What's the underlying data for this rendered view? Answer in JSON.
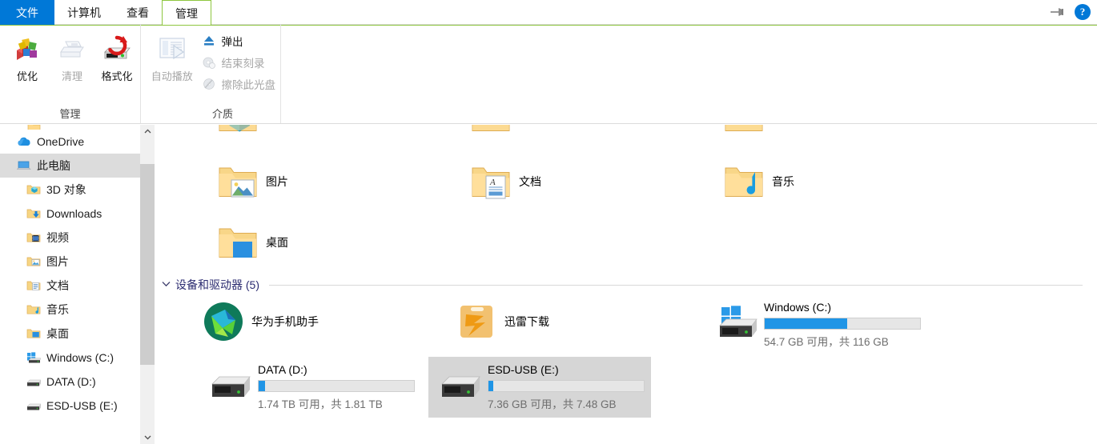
{
  "window": {
    "title": "此电脑"
  },
  "ribbon": {
    "tabs": [
      {
        "label": "文件",
        "type": "file"
      },
      {
        "label": "计算机",
        "type": "normal"
      },
      {
        "label": "查看",
        "type": "normal"
      },
      {
        "label": "管理",
        "type": "contextual-active"
      }
    ],
    "right_controls": [
      {
        "name": "pin-ribbon",
        "label": ""
      },
      {
        "name": "help",
        "label": "?"
      }
    ],
    "groups": [
      {
        "title": "管理",
        "big_buttons": [
          {
            "label": "优化",
            "icon": "optimize-icon",
            "enabled": true
          },
          {
            "label": "清理",
            "icon": "cleanup-icon",
            "enabled": false
          },
          {
            "label": "格式化",
            "icon": "format-icon",
            "enabled": true
          }
        ]
      },
      {
        "title": "介质",
        "big_buttons": [
          {
            "label": "自动播放",
            "icon": "autoplay-icon",
            "enabled": false
          }
        ],
        "small_buttons": [
          {
            "label": "弹出",
            "icon": "eject-icon",
            "enabled": true
          },
          {
            "label": "结束刻录",
            "icon": "finish-burning-icon",
            "enabled": false
          },
          {
            "label": "擦除此光盘",
            "icon": "erase-disc-icon",
            "enabled": false
          }
        ]
      }
    ]
  },
  "navpane": {
    "items": [
      {
        "label": "",
        "icon": "folder-icon",
        "level": 1,
        "selected": false,
        "partial": true
      },
      {
        "label": "OneDrive",
        "icon": "onedrive-icon",
        "level": 0,
        "selected": false
      },
      {
        "label": "此电脑",
        "icon": "this-pc-icon",
        "level": 0,
        "selected": true
      },
      {
        "label": "3D 对象",
        "icon": "folder-3dobjects-icon",
        "level": 1,
        "selected": false
      },
      {
        "label": "Downloads",
        "icon": "folder-downloads-icon",
        "level": 1,
        "selected": false
      },
      {
        "label": "视频",
        "icon": "folder-videos-icon",
        "level": 1,
        "selected": false
      },
      {
        "label": "图片",
        "icon": "folder-pictures-icon",
        "level": 1,
        "selected": false
      },
      {
        "label": "文档",
        "icon": "folder-documents-icon",
        "level": 1,
        "selected": false
      },
      {
        "label": "音乐",
        "icon": "folder-music-icon",
        "level": 1,
        "selected": false
      },
      {
        "label": "桌面",
        "icon": "folder-desktop-icon",
        "level": 1,
        "selected": false
      },
      {
        "label": "Windows (C:)",
        "icon": "windows-drive-icon",
        "level": 1,
        "selected": false
      },
      {
        "label": "DATA (D:)",
        "icon": "hdd-icon",
        "level": 1,
        "selected": false
      },
      {
        "label": "ESD-USB (E:)",
        "icon": "hdd-icon",
        "level": 1,
        "selected": false
      }
    ],
    "scrollbar": {
      "up_arrow": "▲",
      "down_arrow": "⌄"
    }
  },
  "content": {
    "folders": [
      {
        "label": "",
        "icon": "folder-3dobjects-icon",
        "col": 0,
        "row": 0,
        "clipped": true
      },
      {
        "label": "",
        "icon": "folder-downloads-icon",
        "col": 1,
        "row": 0,
        "clipped": true
      },
      {
        "label": "",
        "icon": "folder-videos-icon",
        "col": 2,
        "row": 0,
        "clipped": true
      },
      {
        "label": "图片",
        "icon": "folder-pictures-icon",
        "col": 0,
        "row": 1,
        "clipped": false
      },
      {
        "label": "文档",
        "icon": "folder-documents-icon",
        "col": 1,
        "row": 1,
        "clipped": false
      },
      {
        "label": "音乐",
        "icon": "folder-music-icon",
        "col": 2,
        "row": 1,
        "clipped": false
      },
      {
        "label": "桌面",
        "icon": "folder-desktop-icon",
        "col": 0,
        "row": 2,
        "clipped": false
      }
    ],
    "group_header": {
      "chevron": "⌄",
      "text": "设备和驱动器 (5)"
    },
    "devices": [
      {
        "kind": "app",
        "label": "华为手机助手",
        "icon": "huawei-hisuite-icon",
        "col": 0,
        "row": 0
      },
      {
        "kind": "app",
        "label": "迅雷下载",
        "icon": "thunder-download-icon",
        "col": 1,
        "row": 0
      }
    ],
    "drives": [
      {
        "name": "Windows (C:)",
        "icon": "windows-drive-icon",
        "free_text": "54.7 GB 可用，共 116 GB",
        "used_percent": 53,
        "selected": false,
        "col": 2,
        "row": 0
      },
      {
        "name": "DATA (D:)",
        "icon": "hdd-icon",
        "free_text": "1.74 TB 可用，共 1.81 TB",
        "used_percent": 4,
        "selected": false,
        "col": 0,
        "row": 1
      },
      {
        "name": "ESD-USB (E:)",
        "icon": "hdd-icon",
        "free_text": "7.36 GB 可用，共 7.48 GB",
        "used_percent": 3,
        "selected": true,
        "col": 1,
        "row": 1
      }
    ]
  },
  "colors": {
    "accent": "#0078d7",
    "contextual_green": "#8ec63f",
    "bar_fill": "#2095e6",
    "selection_gray": "#d6d6d6",
    "group_header_text": "#2b2b70"
  }
}
